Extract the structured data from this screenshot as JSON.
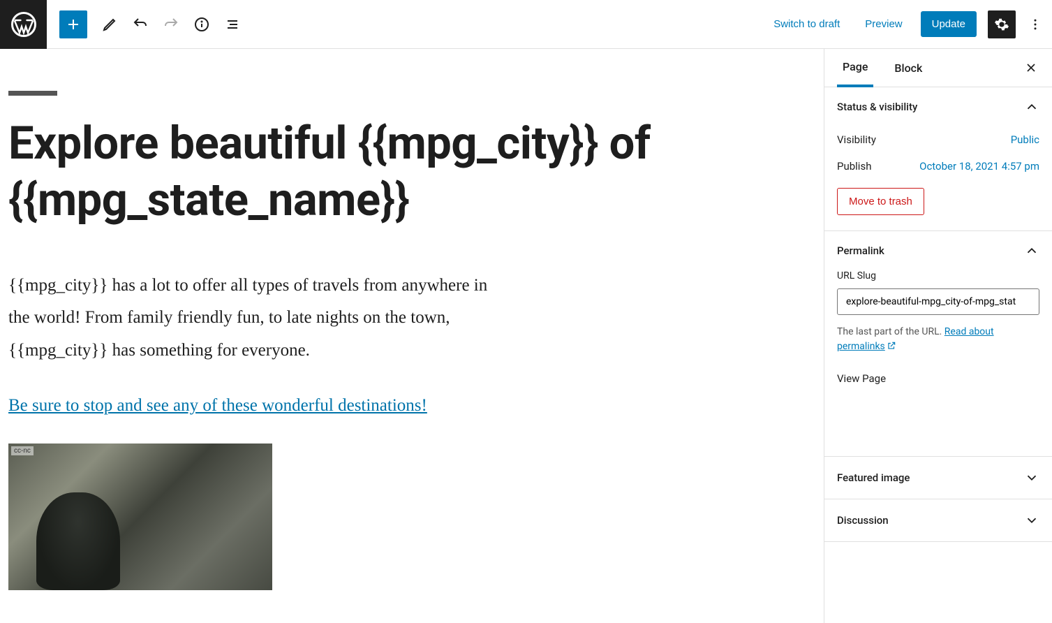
{
  "toolbar": {
    "switch_draft": "Switch to draft",
    "preview": "Preview",
    "update": "Update"
  },
  "tabs": {
    "page": "Page",
    "block": "Block"
  },
  "content": {
    "title": "Explore beautiful {{mpg_city}} of {{mpg_state_name}}",
    "paragraph": "{{mpg_city}} has a lot to offer all types of travels from anywhere in the world! From family friendly fun, to late nights on the town, {{mpg_city}} has something for everyone.",
    "link_text": "Be sure to stop and see any of these wonderful destinations!"
  },
  "status_panel": {
    "title": "Status & visibility",
    "visibility_label": "Visibility",
    "visibility_value": "Public",
    "publish_label": "Publish",
    "publish_value": "October 18, 2021 4:57 pm",
    "trash": "Move to trash"
  },
  "permalink_panel": {
    "title": "Permalink",
    "slug_label": "URL Slug",
    "slug_value": "explore-beautiful-mpg_city-of-mpg_stat",
    "help_prefix": "The last part of the URL. ",
    "help_link": "Read about permalinks",
    "view_page": "View Page"
  },
  "panels": {
    "featured_image": "Featured image",
    "discussion": "Discussion"
  }
}
